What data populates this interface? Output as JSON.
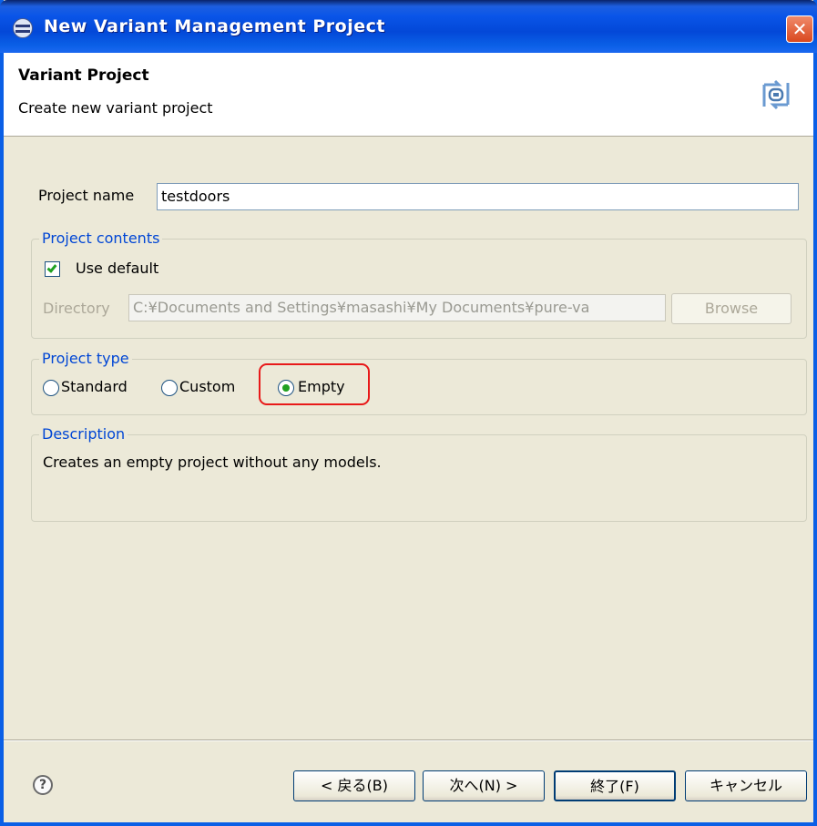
{
  "window": {
    "title": "New Variant Management Project",
    "close_label": "✕"
  },
  "header": {
    "title": "Variant Project",
    "description": "Create new variant project"
  },
  "project_name": {
    "label": "Project name",
    "value": "testdoors"
  },
  "contents_group": {
    "legend": "Project contents",
    "use_default_label": "Use default",
    "use_default_checked": true,
    "directory_label": "Directory",
    "directory_value": "C:¥Documents and Settings¥masashi¥My Documents¥pure-va",
    "browse_label": "Browse"
  },
  "type_group": {
    "legend": "Project type",
    "options": [
      "Standard",
      "Custom",
      "Empty"
    ],
    "selected": "Empty"
  },
  "description_group": {
    "legend": "Description",
    "text": "Creates an empty project without any models."
  },
  "footer": {
    "help_label": "?",
    "back_label": "< 戻る(B)",
    "next_label": "次へ(N) >",
    "finish_label": "終了(F)",
    "cancel_label": "キャンセル"
  },
  "colors": {
    "titlebar": "#0a55e8",
    "legend_text": "#0046d5",
    "highlight": "#e81919",
    "check_green": "#21a121"
  }
}
